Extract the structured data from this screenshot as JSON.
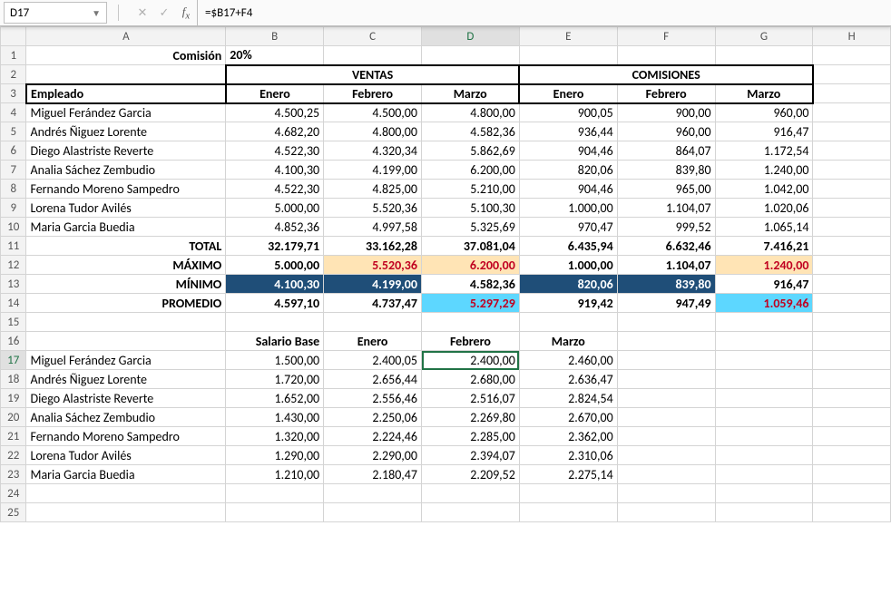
{
  "namebox": "D17",
  "formula": "=$B17+F4",
  "cols": [
    "A",
    "B",
    "C",
    "D",
    "E",
    "F",
    "G",
    "H"
  ],
  "row_labels": {
    "comision": "Comisión",
    "pct": "20%",
    "empleado": "Empleado",
    "total": "TOTAL",
    "max": "MÁXIMO",
    "min": "MÍNIMO",
    "prom": "PROMEDIO",
    "salbase": "Salario Base"
  },
  "section_headers": {
    "ventas": "VENTAS",
    "comisiones": "COMISIONES"
  },
  "months": {
    "enero": "Enero",
    "febrero": "Febrero",
    "marzo": "Marzo"
  },
  "employees": [
    "Miguel Ferández Garcia",
    "Andrés Ñiguez Lorente",
    "Diego Alastriste Reverte",
    "Analia Sáchez Zembudio",
    "Fernando Moreno Sampedro",
    "Lorena Tudor Avilés",
    "Maria Garcia Buedia"
  ],
  "ventas": [
    [
      "4.500,25",
      "4.500,00",
      "4.800,00"
    ],
    [
      "4.682,20",
      "4.800,00",
      "4.582,36"
    ],
    [
      "4.522,30",
      "4.320,34",
      "5.862,69"
    ],
    [
      "4.100,30",
      "4.199,00",
      "6.200,00"
    ],
    [
      "4.522,30",
      "4.825,00",
      "5.210,00"
    ],
    [
      "5.000,00",
      "5.520,36",
      "5.100,30"
    ],
    [
      "4.852,36",
      "4.997,58",
      "5.325,69"
    ]
  ],
  "comisiones": [
    [
      "900,05",
      "900,00",
      "960,00"
    ],
    [
      "936,44",
      "960,00",
      "916,47"
    ],
    [
      "904,46",
      "864,07",
      "1.172,54"
    ],
    [
      "820,06",
      "839,80",
      "1.240,00"
    ],
    [
      "904,46",
      "965,00",
      "1.042,00"
    ],
    [
      "1.000,00",
      "1.104,07",
      "1.020,06"
    ],
    [
      "970,47",
      "999,52",
      "1.065,14"
    ]
  ],
  "totals": {
    "ventas": [
      "32.179,71",
      "33.162,28",
      "37.081,04"
    ],
    "com": [
      "6.435,94",
      "6.632,46",
      "7.416,21"
    ]
  },
  "max": {
    "ventas": [
      "5.000,00",
      "5.520,36",
      "6.200,00"
    ],
    "com": [
      "1.000,00",
      "1.104,07",
      "1.240,00"
    ]
  },
  "min": {
    "ventas": [
      "4.100,30",
      "4.199,00",
      "4.582,36"
    ],
    "com": [
      "820,06",
      "839,80",
      "916,47"
    ]
  },
  "prom": {
    "ventas": [
      "4.597,10",
      "4.737,47",
      "5.297,29"
    ],
    "com": [
      "919,42",
      "947,49",
      "1.059,46"
    ]
  },
  "salario_base": [
    "1.500,00",
    "1.720,00",
    "1.652,00",
    "1.430,00",
    "1.320,00",
    "1.290,00",
    "1.210,00"
  ],
  "salario_mes": [
    [
      "2.400,05",
      "2.400,00",
      "2.460,00"
    ],
    [
      "2.656,44",
      "2.680,00",
      "2.636,47"
    ],
    [
      "2.556,46",
      "2.516,07",
      "2.824,54"
    ],
    [
      "2.250,06",
      "2.269,80",
      "2.670,00"
    ],
    [
      "2.224,46",
      "2.285,00",
      "2.362,00"
    ],
    [
      "2.290,00",
      "2.394,07",
      "2.310,06"
    ],
    [
      "2.180,47",
      "2.209,52",
      "2.275,14"
    ]
  ],
  "selected_cell": "D17"
}
